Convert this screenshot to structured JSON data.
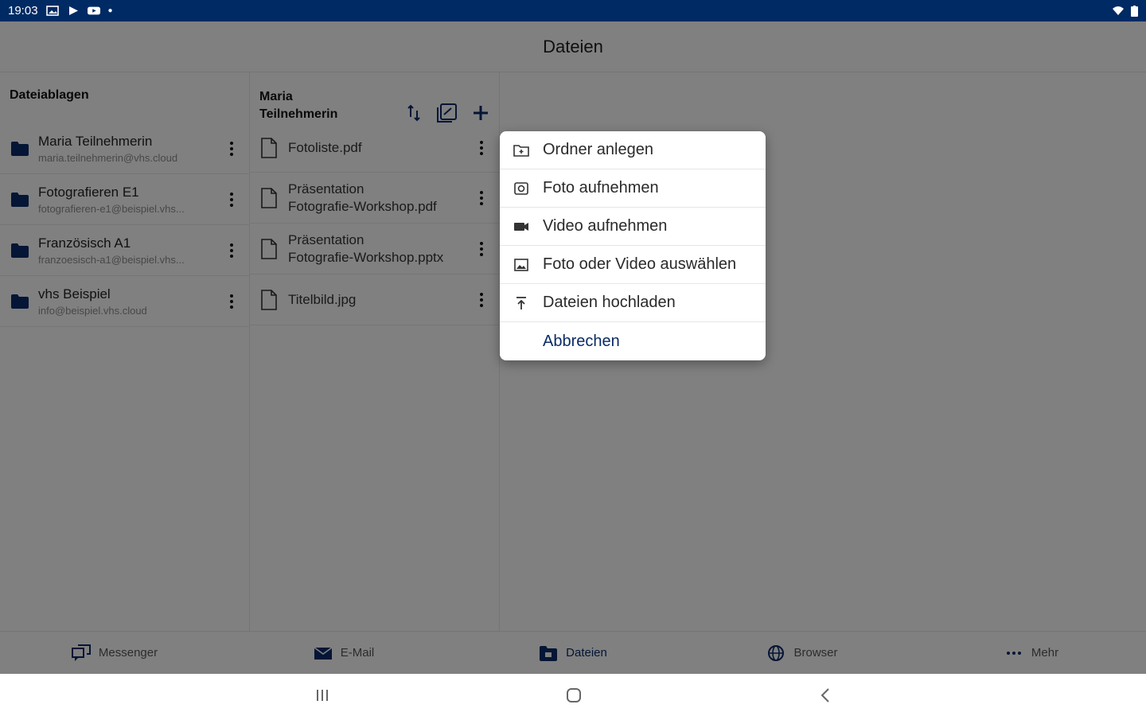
{
  "status_bar": {
    "time": "19:03"
  },
  "header": {
    "title": "Dateien"
  },
  "stores": {
    "heading": "Dateiablagen",
    "items": [
      {
        "name": "Maria Teilnehmerin",
        "email": "maria.teilnehmerin@vhs.cloud"
      },
      {
        "name": "Fotografieren E1",
        "email": "fotografieren-e1@beispiel.vhs..."
      },
      {
        "name": "Französisch A1",
        "email": "franzoesisch-a1@beispiel.vhs..."
      },
      {
        "name": "vhs Beispiel",
        "email": "info@beispiel.vhs.cloud"
      }
    ]
  },
  "files": {
    "heading_line1": "Maria",
    "heading_line2": "Teilnehmerin",
    "items": [
      {
        "line1": "Fotoliste.pdf",
        "line2": ""
      },
      {
        "line1": "Präsentation",
        "line2": "Fotografie-Workshop.pdf"
      },
      {
        "line1": "Präsentation",
        "line2": "Fotografie-Workshop.pptx"
      },
      {
        "line1": "Titelbild.jpg",
        "line2": ""
      }
    ]
  },
  "menu": {
    "items": [
      {
        "label": "Ordner anlegen",
        "icon": "folder-add-icon"
      },
      {
        "label": "Foto aufnehmen",
        "icon": "camera-icon"
      },
      {
        "label": "Video aufnehmen",
        "icon": "video-camera-icon"
      },
      {
        "label": "Foto oder Video auswählen",
        "icon": "image-icon"
      },
      {
        "label": "Dateien hochladen",
        "icon": "upload-icon"
      }
    ],
    "cancel_label": "Abbrechen"
  },
  "bottom_nav": {
    "items": [
      {
        "label": "Messenger",
        "icon": "messenger-icon"
      },
      {
        "label": "E-Mail",
        "icon": "mail-icon"
      },
      {
        "label": "Dateien",
        "icon": "files-icon"
      },
      {
        "label": "Browser",
        "icon": "globe-icon"
      },
      {
        "label": "Mehr",
        "icon": "more-icon"
      }
    ],
    "active": "Dateien"
  },
  "colors": {
    "accent": "#0a2a66",
    "status_bar": "#002a63",
    "scrim": "rgba(0,0,0,0.48)"
  }
}
